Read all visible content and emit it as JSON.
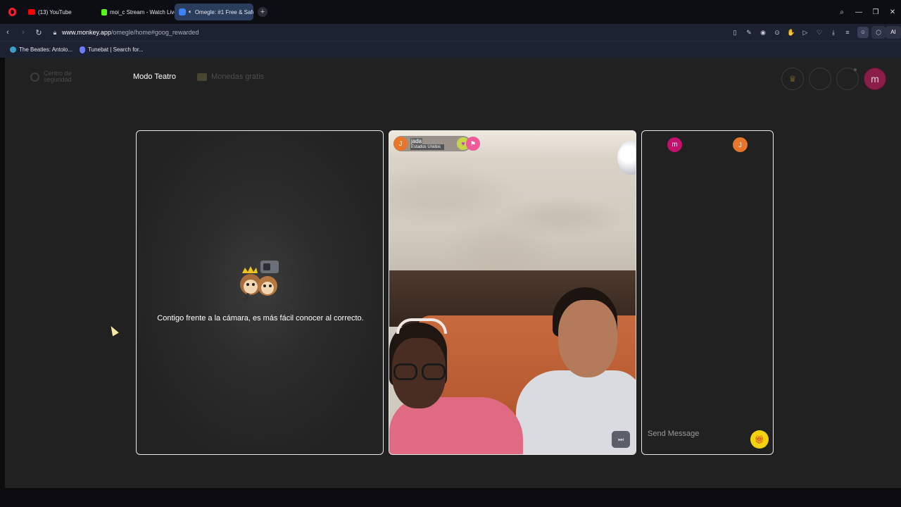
{
  "browser": {
    "tabs": [
      {
        "label": "(13) YouTube"
      },
      {
        "label": "moi_c Stream - Watch Live"
      },
      {
        "label": "Omegle: #1 Free & Safe"
      }
    ],
    "new_tab_label": "+",
    "url_domain": "www.monkey.app",
    "url_path": "/omegle/home#goog_rewarded",
    "ai_label": "AI",
    "bookmarks": [
      {
        "label": "The Beatles: Antolo..."
      },
      {
        "label": "Tunebat | Search for..."
      }
    ]
  },
  "topnav": {
    "safety_label": "Centro de seguridad",
    "theater_label": "Modo Teatro",
    "coins_label": "Monedas gratis",
    "avatar_initial": "m"
  },
  "left_panel": {
    "message": "Contigo frente a la cámara, es más fácil conocer al correcto."
  },
  "video": {
    "user_initial": "J",
    "username": "jada",
    "country": "Estados Unidos"
  },
  "chat": {
    "me_initial": "m",
    "peer_initial": "J",
    "placeholder": "Send Message"
  },
  "colors": {
    "page_bg": "#212121",
    "accent_gift": "#f5d20f",
    "avatar_me": "#c1116a",
    "avatar_peer": "#e8762a"
  }
}
